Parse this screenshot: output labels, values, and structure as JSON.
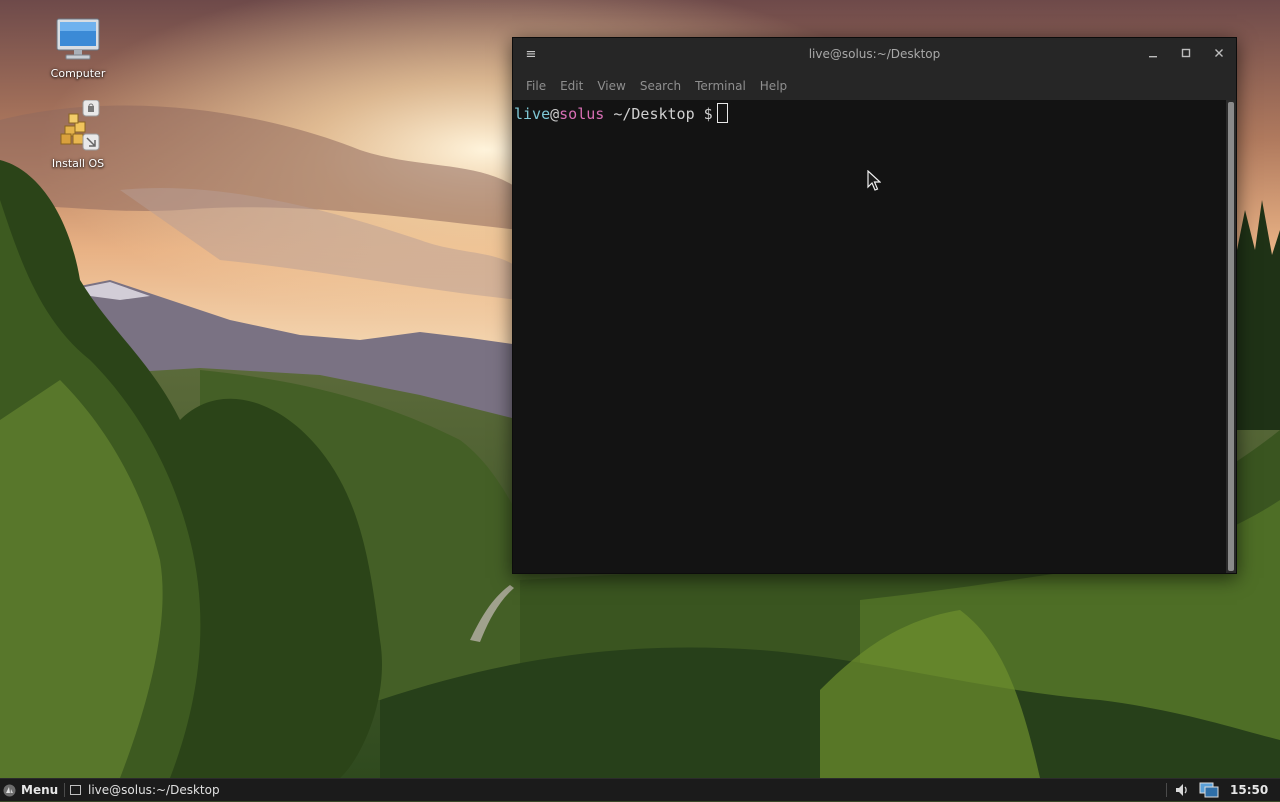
{
  "desktop": {
    "icons": [
      {
        "label": "Computer",
        "icon": "computer-icon"
      },
      {
        "label": "Install OS",
        "icon": "installer-icon"
      }
    ]
  },
  "terminal": {
    "title": "live@solus:~/Desktop",
    "menu": [
      "File",
      "Edit",
      "View",
      "Search",
      "Terminal",
      "Help"
    ],
    "prompt": {
      "user": "live",
      "at": "@",
      "host": "solus",
      "path": "~/Desktop",
      "symbol": "$"
    }
  },
  "taskbar": {
    "menu_label": "Menu",
    "task_label": "live@solus:~/Desktop",
    "clock": "15:50"
  },
  "colors": {
    "prompt_user": "#7fc8d6",
    "prompt_host": "#d86fb5",
    "terminal_bg": "#131313"
  }
}
